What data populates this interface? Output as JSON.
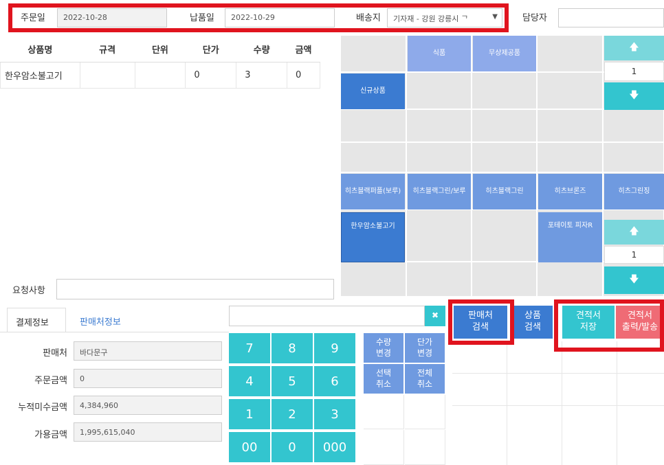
{
  "header": {
    "order_date_label": "주문일",
    "order_date": "2022-10-28",
    "delivery_date_label": "납품일",
    "delivery_date": "2022-10-29",
    "shipping_label": "배송지",
    "shipping_value": "기자재 - 강원 강릉시 ᄀ",
    "manager_label": "담당자",
    "manager_value": ""
  },
  "table": {
    "headers": [
      "상품명",
      "규격",
      "단위",
      "단가",
      "수량",
      "금액"
    ],
    "rows": [
      [
        "한우암소불고기",
        "",
        "",
        "0",
        "3",
        "0"
      ]
    ]
  },
  "grid": {
    "cat1": "식품",
    "cat2": "무상제공품",
    "new_product": "신규상품",
    "p1": "히츠블랙퍼플(보루)",
    "p2": "히츠블랙그린/보루",
    "p3": "히츠블랙그린",
    "p4": "히츠브론즈",
    "p5": "히츠그린징",
    "p6": "한우암소불고기",
    "p7": "포테이토 피자R",
    "page_top": "1",
    "page_bottom": "1",
    "up_icon": "arrow-up-icon",
    "down_icon": "arrow-down-icon"
  },
  "request": {
    "label": "요청사항",
    "value": ""
  },
  "tabs": {
    "payment": "결제정보",
    "seller": "판매처정보"
  },
  "info": {
    "seller_label": "판매처",
    "seller": "바다문구",
    "order_amount_label": "주문금액",
    "order_amount": "0",
    "unpaid_label": "누적미수금액",
    "unpaid": "4,384,960",
    "available_label": "가용금액",
    "available": "1,995,615,040"
  },
  "keypad": {
    "keys": [
      "7",
      "8",
      "9",
      "4",
      "5",
      "6",
      "1",
      "2",
      "3",
      "00",
      "0",
      "000"
    ],
    "qty_change": "수량\n변경",
    "price_change": "단가\n변경",
    "select_cancel": "선택\n취소",
    "all_cancel": "전체\n취소",
    "clear_icon": "close-icon"
  },
  "actions": {
    "seller_search": "판매처\n검색",
    "product_search": "상품\n검색",
    "quote_save": "견적서\n저장",
    "quote_print": "견적서\n출력/발송"
  },
  "colors": {
    "blue": "#6f9ae0",
    "teal": "#33c5cf",
    "red_highlight": "#e0141e",
    "pink": "#ef6b75"
  }
}
